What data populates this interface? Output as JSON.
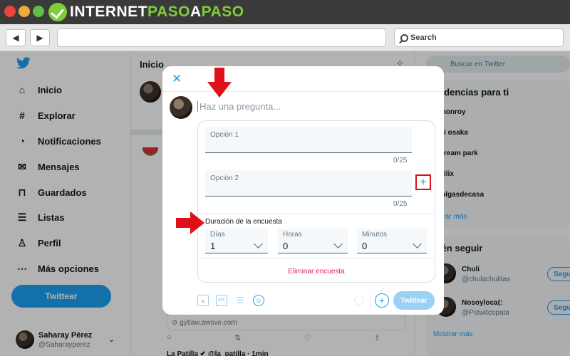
{
  "site": {
    "logo_prefix": "INTERNET",
    "logo_green": "PASO",
    "logo_mid": "A",
    "logo_suffix": "PASO",
    "search_label": "Search"
  },
  "sidebar": {
    "items": [
      {
        "icon": "house-icon",
        "glyph": "⌂",
        "label": "Inicio"
      },
      {
        "icon": "hashtag-icon",
        "glyph": "#",
        "label": "Explorar"
      },
      {
        "icon": "bell-icon",
        "glyph": "◔",
        "label": "Notificaciones"
      },
      {
        "icon": "envelope-icon",
        "glyph": "✉",
        "label": "Mensajes"
      },
      {
        "icon": "bookmark-icon",
        "glyph": "⊓",
        "label": "Guardados"
      },
      {
        "icon": "list-icon",
        "glyph": "☰",
        "label": "Listas"
      },
      {
        "icon": "person-icon",
        "glyph": "♙",
        "label": "Perfil"
      },
      {
        "icon": "more-icon",
        "glyph": "⋯",
        "label": "Más opciones"
      }
    ],
    "tweet_button": "Twittear",
    "profile": {
      "name": "Saharay Pérez",
      "handle": "@Saharayperez"
    }
  },
  "timeline": {
    "title": "Inicio",
    "link_card": "gytlaw.awsve.com",
    "next_tweet": "La Patilla ✔ @la_patilla · 1min"
  },
  "right": {
    "search_placeholder": "Buscar en Twitter",
    "trends_title": "endencias para ti",
    "trends": [
      "n monroy",
      "omi osaka",
      "lfstream park",
      "n félix",
      "osalgasdecasa"
    ],
    "show_more": "ostrar más",
    "follow_title": "uién seguir",
    "follow": [
      {
        "name": "Chuli",
        "handle": "@chulachulitas",
        "button": "Segu"
      },
      {
        "name": "Nosoyloca(:",
        "handle": "@Pstwitcopata",
        "button": "Segu"
      }
    ],
    "follow_more": "Mostrar más"
  },
  "compose": {
    "question_placeholder": "Haz una pregunta...",
    "options": [
      {
        "label": "Opción 1",
        "count": "0/25"
      },
      {
        "label": "Opción 2",
        "count": "0/25"
      }
    ],
    "duration_title": "Duración de la encuesta",
    "duration": [
      {
        "label": "Días",
        "value": "1"
      },
      {
        "label": "Horas",
        "value": "0"
      },
      {
        "label": "Minutos",
        "value": "0"
      }
    ],
    "remove_poll": "Eliminar encuesta",
    "tool_gif": "GIF",
    "submit": "Twittear"
  },
  "colors": {
    "accent": "#1da1f2",
    "annotation": "#e0101a",
    "danger": "#e0245e"
  }
}
